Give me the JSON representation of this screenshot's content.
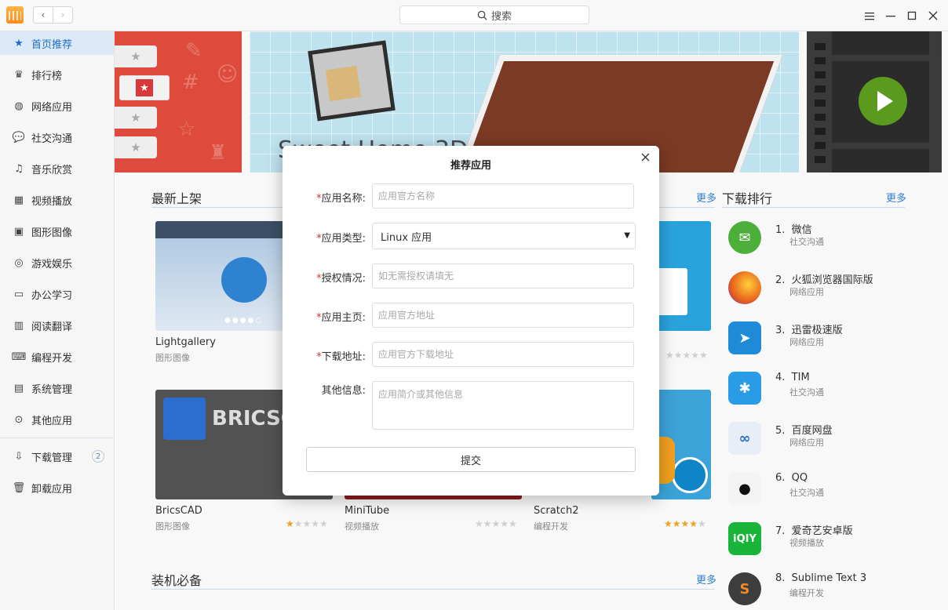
{
  "search": {
    "label": "搜索"
  },
  "sidebar": {
    "items": [
      {
        "label": "首页推荐",
        "icon": "star-icon"
      },
      {
        "label": "排行榜",
        "icon": "crown-icon"
      },
      {
        "label": "网络应用",
        "icon": "globe-icon"
      },
      {
        "label": "社交沟通",
        "icon": "chat-icon"
      },
      {
        "label": "音乐欣赏",
        "icon": "music-icon"
      },
      {
        "label": "视频播放",
        "icon": "film-icon"
      },
      {
        "label": "图形图像",
        "icon": "image-icon"
      },
      {
        "label": "游戏娱乐",
        "icon": "gamepad-icon"
      },
      {
        "label": "办公学习",
        "icon": "monitor-icon"
      },
      {
        "label": "阅读翻译",
        "icon": "book-icon"
      },
      {
        "label": "编程开发",
        "icon": "terminal-icon"
      },
      {
        "label": "系统管理",
        "icon": "settings-icon"
      },
      {
        "label": "其他应用",
        "icon": "more-icon"
      }
    ],
    "bottom": [
      {
        "label": "下载管理",
        "icon": "download-icon",
        "badge": "2"
      },
      {
        "label": "卸载应用",
        "icon": "trash-icon"
      }
    ]
  },
  "banner": {
    "title": "Sweet Home 3D"
  },
  "sections": {
    "new": {
      "title": "最新上架",
      "more": "更多"
    },
    "ranking": {
      "title": "下载排行",
      "more": "更多"
    },
    "essential": {
      "title": "装机必备",
      "more": "更多"
    }
  },
  "new_apps": [
    {
      "name": "Lightgallery",
      "category": "图形图像",
      "rating": 0
    },
    {
      "name": "BricsCAD",
      "category": "图形图像",
      "rating": 0.5
    },
    {
      "name": "MiniTube",
      "category": "视频播放",
      "rating": 0
    },
    {
      "name": "Scratch2",
      "category": "编程开发",
      "rating": 4
    },
    {
      "name": "",
      "category": "",
      "rating": 0
    }
  ],
  "ranking": [
    {
      "rank": "1.",
      "name": "微信",
      "category": "社交沟通",
      "color": "#4caf3a"
    },
    {
      "rank": "2.",
      "name": "火狐浏览器国际版",
      "category": "网络应用",
      "color": "#e8601c"
    },
    {
      "rank": "3.",
      "name": "迅雷极速版",
      "category": "网络应用",
      "color": "#1f8ad8"
    },
    {
      "rank": "4.",
      "name": "TIM",
      "category": "社交沟通",
      "color": "#2a9be6"
    },
    {
      "rank": "5.",
      "name": "百度网盘",
      "category": "网络应用",
      "color": "#e8eef6"
    },
    {
      "rank": "6.",
      "name": "QQ",
      "category": "社交沟通",
      "color": "#f4f4f4"
    },
    {
      "rank": "7.",
      "name": "爱奇艺安卓版",
      "category": "视频播放",
      "color": "#18b53a"
    },
    {
      "rank": "8.",
      "name": "Sublime Text 3",
      "category": "编程开发",
      "color": "#3d3d3d"
    }
  ],
  "dialog": {
    "title": "推荐应用",
    "fields": {
      "name": {
        "label": "应用名称:",
        "placeholder": "应用官方名称",
        "required": true
      },
      "type": {
        "label": "应用类型:",
        "value": "Linux 应用",
        "required": true
      },
      "license": {
        "label": "授权情况:",
        "placeholder": "如无需授权请填无",
        "required": true
      },
      "homepage": {
        "label": "应用主页:",
        "placeholder": "应用官方地址",
        "required": true
      },
      "download": {
        "label": "下载地址:",
        "placeholder": "应用官方下载地址",
        "required": true
      },
      "other": {
        "label": "其他信息:",
        "placeholder": "应用简介或其他信息",
        "required": false
      }
    },
    "submit": "提交"
  },
  "colors": {
    "accent": "#2f7fd9",
    "required": "#e03030",
    "active_bg": "#dbe9f8"
  }
}
